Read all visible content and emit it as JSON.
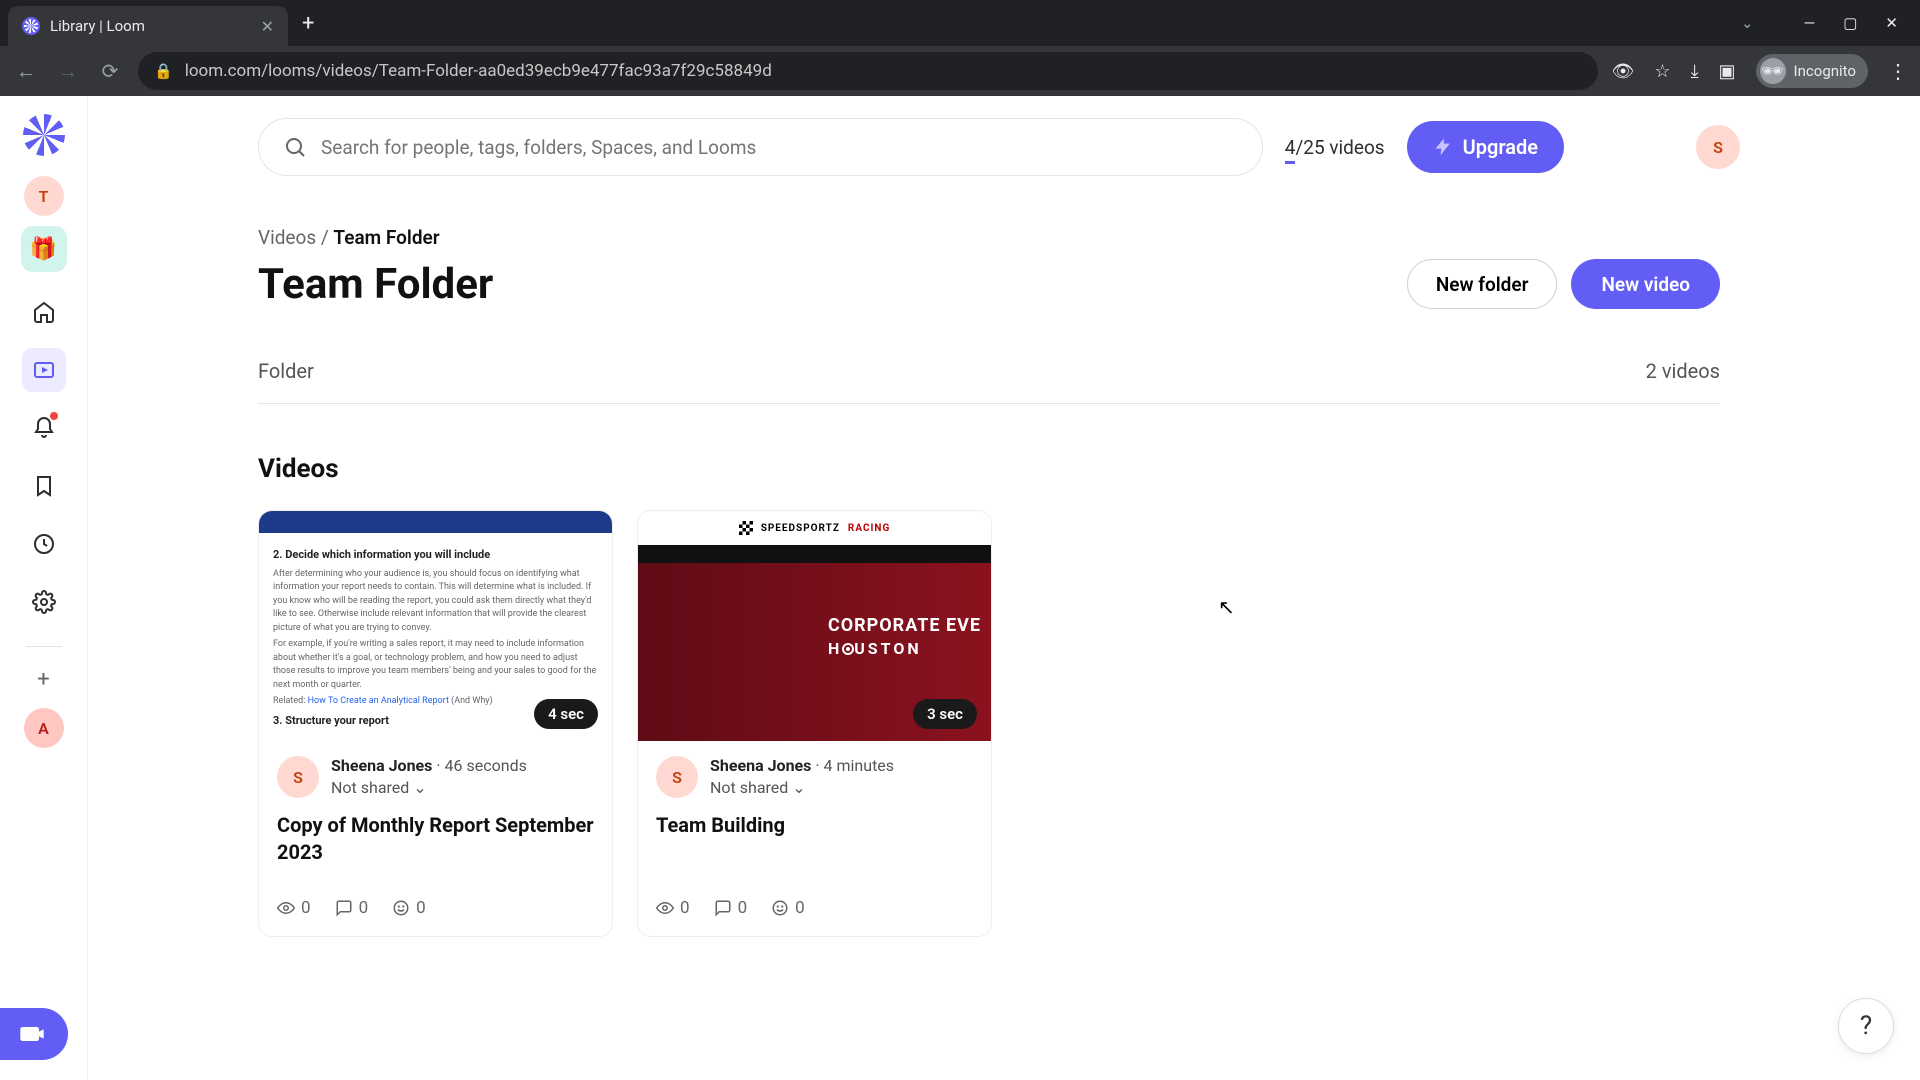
{
  "browser": {
    "tab_title": "Library | Loom",
    "url": "loom.com/looms/videos/Team-Folder-aa0ed39ecb9e477fac93a7f29c58849d",
    "incognito_label": "Incognito"
  },
  "sidebar": {
    "workspace_initial": "T",
    "add_workspace_initial": "A"
  },
  "topbar": {
    "search_placeholder": "Search for people, tags, folders, Spaces, and Looms",
    "quota_used": "4",
    "quota_total": "/25 videos",
    "upgrade_label": "Upgrade",
    "user_initial": "S"
  },
  "breadcrumb": {
    "root": "Videos",
    "sep": " / ",
    "current": "Team Folder"
  },
  "page": {
    "title": "Team Folder",
    "new_folder_label": "New folder",
    "new_video_label": "New video",
    "section_label": "Folder",
    "section_count": "2 videos",
    "videos_heading": "Videos"
  },
  "cards": [
    {
      "duration": "4 sec",
      "author_initial": "S",
      "author_name": "Sheena Jones",
      "meta_sep": " · ",
      "ago": "46 seconds",
      "share_state": "Not shared",
      "title": "Copy of Monthly Report September 2023",
      "views": "0",
      "comments": "0",
      "reactions": "0"
    },
    {
      "duration": "3 sec",
      "author_initial": "S",
      "author_name": "Sheena Jones",
      "meta_sep": " · ",
      "ago": "4 minutes",
      "share_state": "Not shared",
      "title": "Team Building",
      "views": "0",
      "comments": "0",
      "reactions": "0"
    }
  ],
  "thumb1": {
    "h1": "2. Decide which information you will include",
    "p1": "After determining who your audience is, you should focus on identifying what information your report needs to contain. This will determine what is included. If you know who will be reading the report, you could ask them directly what they'd like to see. Otherwise include relevant information that will provide the clearest picture of what you are trying to convey.",
    "p2": "For example, if you're writing a sales report, it may need to include information about whether it's a goal, or technology problem, and how you need to adjust those results to improve you team members' being and your sales to good for the next month or quarter.",
    "p3a": "Related: ",
    "p3b": "How To Create an Analytical Report",
    "p3c": " (And Why)",
    "h2": "3. Structure your report"
  },
  "thumb2": {
    "brand1": "SPEEDSPORTZ",
    "brand2": "RACING",
    "line1": "CORPORATE EVE",
    "line2": "HOUSTON"
  }
}
